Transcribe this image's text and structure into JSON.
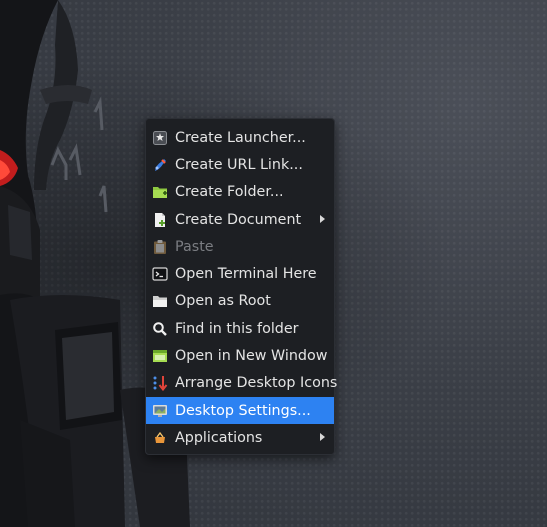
{
  "desktop": {
    "context_menu": {
      "items": [
        {
          "label": "Create Launcher..."
        },
        {
          "label": "Create URL Link..."
        },
        {
          "label": "Create Folder..."
        },
        {
          "label": "Create Document"
        },
        {
          "label": "Paste"
        },
        {
          "label": "Open Terminal Here"
        },
        {
          "label": "Open as Root"
        },
        {
          "label": "Find in this folder"
        },
        {
          "label": "Open in New Window"
        },
        {
          "label": "Arrange Desktop Icons"
        },
        {
          "label": "Desktop Settings..."
        },
        {
          "label": "Applications"
        }
      ]
    }
  },
  "colors": {
    "menu_bg": "#1d1f23",
    "selection": "#2d82f2",
    "text": "#e4e4e4",
    "disabled_text": "#7b7d82",
    "folder_green": "#8ec940",
    "wallpaper": "#3b3f47"
  }
}
